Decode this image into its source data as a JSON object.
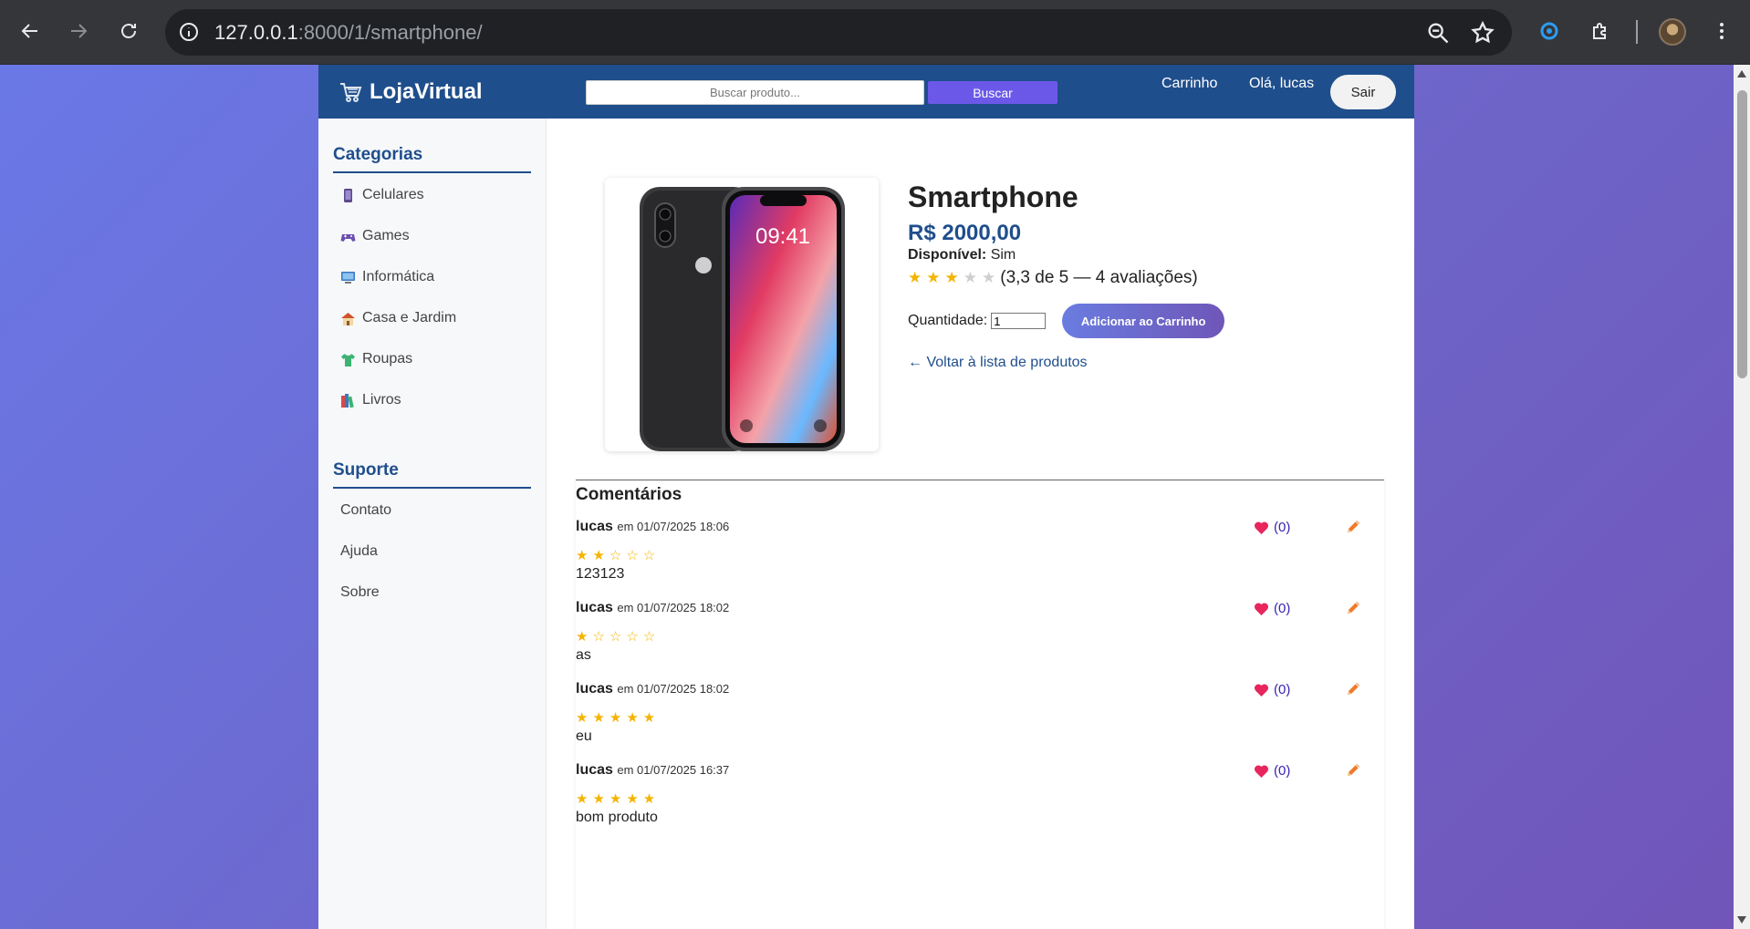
{
  "browser": {
    "url_host": "127.0.0.1",
    "url_rest": ":8000/1/smartphone/"
  },
  "header": {
    "logo_text": "LojaVirtual",
    "search_placeholder": "Buscar produto...",
    "search_button": "Buscar",
    "cart_link": "Carrinho",
    "greeting": "Olá, lucas",
    "logout_button": "Sair"
  },
  "sidebar": {
    "categories_heading": "Categorias",
    "categories": [
      {
        "label": "Celulares",
        "icon": "phone-icon"
      },
      {
        "label": "Games",
        "icon": "gamepad-icon"
      },
      {
        "label": "Informática",
        "icon": "computer-icon"
      },
      {
        "label": "Casa e Jardim",
        "icon": "house-icon"
      },
      {
        "label": "Roupas",
        "icon": "shirt-icon"
      },
      {
        "label": "Livros",
        "icon": "books-icon"
      }
    ],
    "support_heading": "Suporte",
    "support_links": [
      "Contato",
      "Ajuda",
      "Sobre"
    ]
  },
  "product": {
    "name": "Smartphone",
    "price": "R$ 2000,00",
    "availability_label": "Disponível:",
    "availability_value": "Sim",
    "rating_value": 3.3,
    "rating_text": "(3,3 de 5 — 4 avaliações)",
    "quantity_label": "Quantidade:",
    "quantity_value": "1",
    "add_to_cart_button": "Adicionar ao Carrinho",
    "back_link": "← Voltar à lista de produtos"
  },
  "comments": {
    "title": "Comentários",
    "items": [
      {
        "author": "lucas",
        "meta": "em 01/07/2025 18:06",
        "stars": "★★☆☆☆",
        "rating": 2,
        "text": "123123",
        "likes": "(0)"
      },
      {
        "author": "lucas",
        "meta": "em 01/07/2025 18:02",
        "stars": "★☆☆☆☆",
        "rating": 1,
        "text": "as",
        "likes": "(0)"
      },
      {
        "author": "lucas",
        "meta": "em 01/07/2025 18:02",
        "stars": "★★★★★",
        "rating": 5,
        "text": "eu",
        "likes": "(0)"
      },
      {
        "author": "lucas",
        "meta": "em 01/07/2025 16:37",
        "stars": "★★★★★",
        "rating": 5,
        "text": "bom produto",
        "likes": "(0)"
      }
    ]
  },
  "colors": {
    "header_bg": "#1f4e8c",
    "accent": "#6b58e8",
    "star": "#f5b400",
    "heart": "#e8265e",
    "edit": "#f07a2a"
  }
}
